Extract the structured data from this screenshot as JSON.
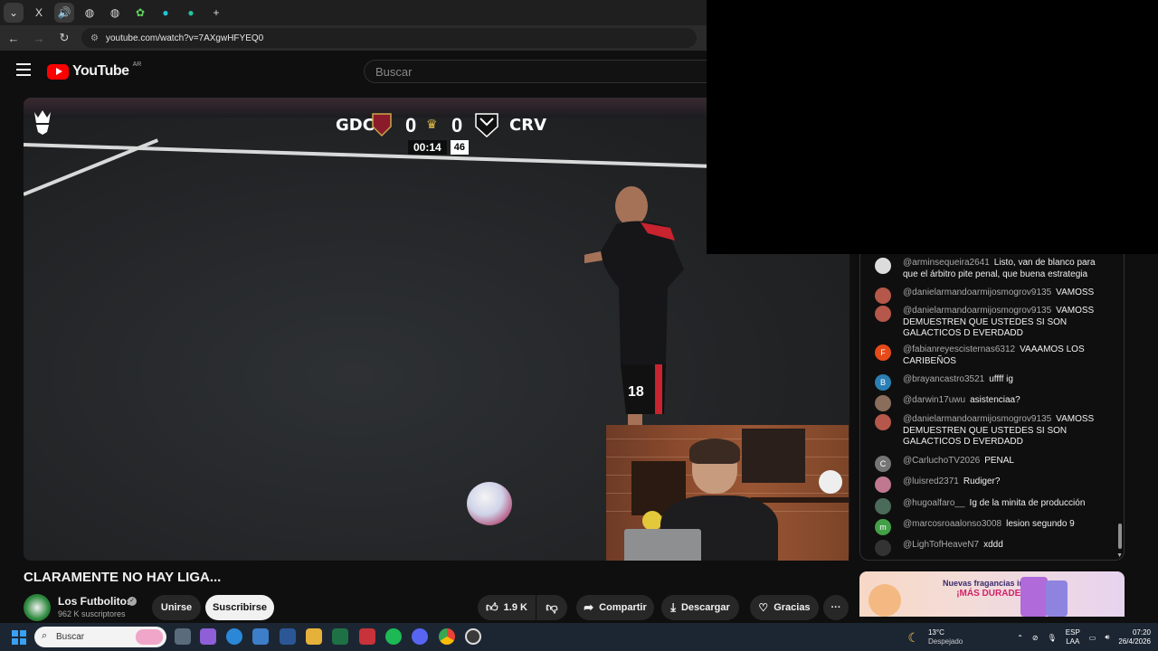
{
  "browser": {
    "url": "youtube.com/watch?v=7AXgwHFYEQ0",
    "new_tab": "+"
  },
  "youtube": {
    "logo_text": "YouTube",
    "country": "AR",
    "search_placeholder": "Buscar"
  },
  "video": {
    "scoreboard": {
      "home": "GDC",
      "away": "CRV",
      "home_score": "0",
      "away_score": "0",
      "time": "00:14",
      "count": "46"
    },
    "player_number": "18"
  },
  "chat": {
    "messages": [
      {
        "author": "@arminsequeira2641",
        "text": "Listo, van de blanco para que el árbitro pite penal, que buena estrategia",
        "avatar": "",
        "color": "#dcdcdc"
      },
      {
        "author": "@danielarmandoarmijosmogrov9135",
        "text": "VAMOSS",
        "avatar": "",
        "color": "#b5574a"
      },
      {
        "author": "@danielarmandoarmijosmogrov9135",
        "text": "VAMOSS DEMUESTREN QUE USTEDES SI SON GALACTICOS D EVERDADD",
        "avatar": "",
        "color": "#b5574a"
      },
      {
        "author": "@fabianreyescisternas6312",
        "text": "VAAAMOS LOS CARIBEÑOS",
        "avatar": "F",
        "color": "#e64a19"
      },
      {
        "author": "@brayancastro3521",
        "text": "uffff ig",
        "avatar": "B",
        "color": "#2a7fb5"
      },
      {
        "author": "@darwin17uwu",
        "text": "asistenciaa?",
        "avatar": "",
        "color": "#8a6d5a"
      },
      {
        "author": "@danielarmandoarmijosmogrov9135",
        "text": "VAMOSS DEMUESTREN QUE USTEDES SI SON GALACTICOS D EVERDADD",
        "avatar": "",
        "color": "#b5574a"
      },
      {
        "author": "@CarluchoTV2026",
        "text": "PENAL",
        "avatar": "C",
        "color": "#757575"
      },
      {
        "author": "@luisred2371",
        "text": "Rudiger?",
        "avatar": "",
        "color": "#c07890"
      },
      {
        "author": "@hugoalfaro__",
        "text": "Ig de la minita de producción",
        "avatar": "",
        "color": "#4a6a5a"
      },
      {
        "author": "@marcosroaalonso3008",
        "text": "lesion segundo 9",
        "avatar": "m",
        "color": "#43a047"
      },
      {
        "author": "@LighTofHeaveN7",
        "text": "xddd",
        "avatar": "",
        "color": "#333333"
      }
    ]
  },
  "ad": {
    "line1": "Nuevas fragancias intensas y",
    "line2": "¡MÁS DURADERAS!"
  },
  "video_info": {
    "title": "CLARAMENTE NO HAY LIGA...",
    "channel": "Los Futbolitos",
    "subscribers": "962 K suscriptores",
    "join_label": "Unirse",
    "subscribe_label": "Suscribirse",
    "likes": "1.9 K",
    "share_label": "Compartir",
    "download_label": "Descargar",
    "thanks_label": "Gracias",
    "more_label": "···"
  },
  "taskbar": {
    "search_placeholder": "Buscar",
    "weather_temp": "13°C",
    "weather_desc": "Despejado",
    "lang_1": "ESP",
    "lang_2": "LAA",
    "time": "07:20",
    "date": "26/4/2026"
  },
  "colors": {
    "youtube_red": "#ff0000",
    "background": "#0f0f0f",
    "taskbar": "#1c2633"
  }
}
